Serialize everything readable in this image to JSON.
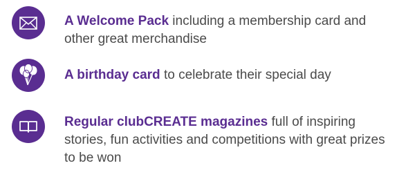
{
  "colors": {
    "brand": "#5a2d91",
    "text": "#4a4a4a",
    "background": "#ffffff"
  },
  "benefits": [
    {
      "icon": "envelope-icon",
      "highlight": "A Welcome Pack",
      "rest": " including a membership card and other great merchandise"
    },
    {
      "icon": "balloons-icon",
      "highlight": "A birthday card",
      "rest": " to celebrate their special day"
    },
    {
      "icon": "book-icon",
      "highlight": "Regular clubCREATE magazines",
      "rest": " full of inspiring stories, fun activities and competitions with great prizes to be won"
    }
  ]
}
